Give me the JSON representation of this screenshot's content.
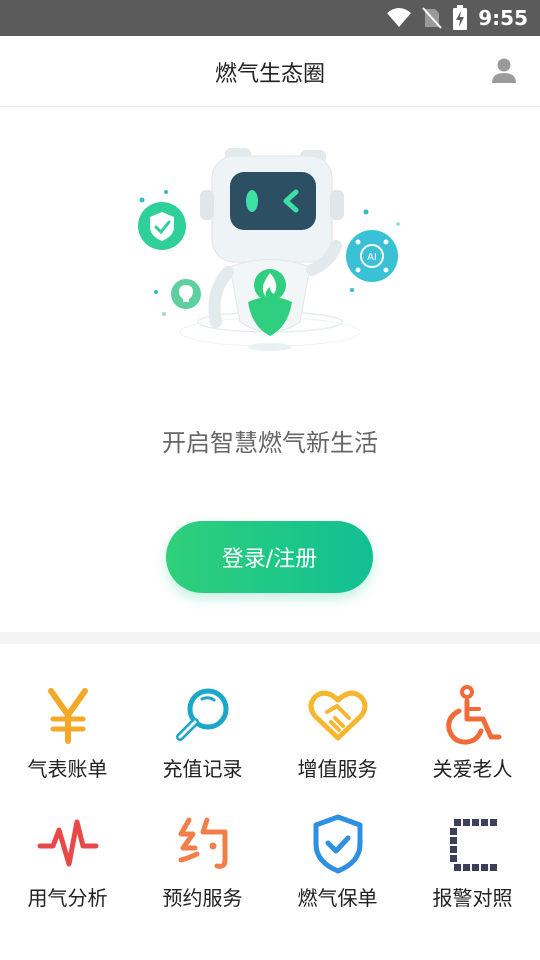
{
  "status_bar": {
    "time": "9:55"
  },
  "header": {
    "title": "燃气生态圈"
  },
  "hero": {
    "slogan": "开启智慧燃气新生活",
    "login_label": "登录/注册",
    "robot_ai_badge": "AI"
  },
  "services": [
    {
      "label": "气表账单",
      "icon": "yen-icon",
      "color": "#f4a828"
    },
    {
      "label": "充值记录",
      "icon": "magnifier-icon",
      "color": "#1aa7c9"
    },
    {
      "label": "增值服务",
      "icon": "heart-handshake-icon",
      "color": "#f5b630"
    },
    {
      "label": "关爱老人",
      "icon": "wheelchair-icon",
      "color": "#f06a3a"
    },
    {
      "label": "用气分析",
      "icon": "pulse-icon",
      "color": "#e84848"
    },
    {
      "label": "预约服务",
      "icon": "appointment-icon",
      "color": "#f07f4a"
    },
    {
      "label": "燃气保单",
      "icon": "shield-check-icon",
      "color": "#2f8fe0"
    },
    {
      "label": "报警对照",
      "icon": "alarm-grid-icon",
      "color": "#3c3f5c"
    }
  ]
}
